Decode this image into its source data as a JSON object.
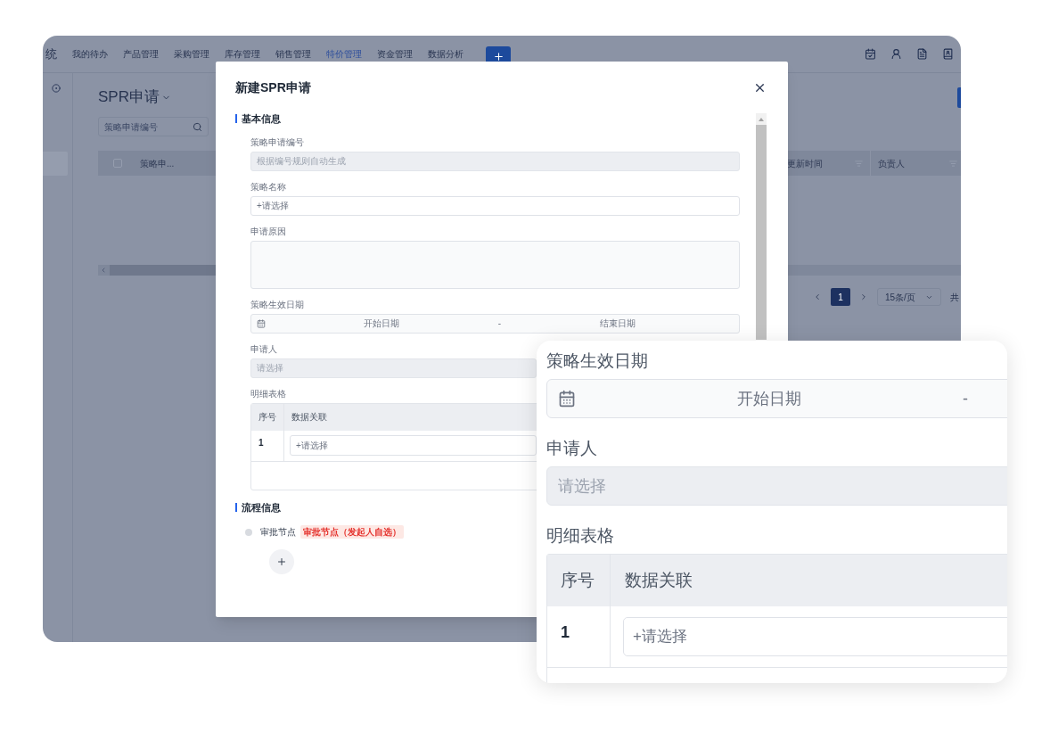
{
  "app": {
    "title_fragment": "统",
    "nav": [
      {
        "label": "我的待办",
        "selected": false
      },
      {
        "label": "产品管理",
        "selected": false
      },
      {
        "label": "采购管理",
        "selected": false
      },
      {
        "label": "库存管理",
        "selected": false
      },
      {
        "label": "销售管理",
        "selected": false
      },
      {
        "label": "特价管理",
        "selected": true
      },
      {
        "label": "资金管理",
        "selected": false
      },
      {
        "label": "数据分析",
        "selected": false
      }
    ]
  },
  "main": {
    "title": "SPR申请",
    "search_placeholder": "策略申请编号",
    "header_checkbox": {
      "checked": false
    },
    "columns": [
      {
        "label": "策略申..."
      },
      {
        "label": "更新时间"
      },
      {
        "label": "负责人"
      }
    ],
    "pagination": {
      "pages": [
        {
          "label": "1",
          "selected": true
        }
      ],
      "page_size": "15条/页",
      "total": "共"
    }
  },
  "modal": {
    "title": "新建SPR申请",
    "section_basic": "基本信息",
    "fields": [
      {
        "kind": "input",
        "label": "策略申请编号",
        "placeholder": "根据编号规则自动生成",
        "disabled": true
      },
      {
        "kind": "input",
        "label": "策略名称",
        "placeholder": "+请选择",
        "disabled": false
      },
      {
        "kind": "textarea",
        "label": "申请原因"
      },
      {
        "kind": "daterange",
        "label": "策略生效日期",
        "start": "开始日期",
        "separator": "-",
        "end": "结束日期"
      },
      {
        "kind": "input",
        "label": "申请人",
        "placeholder": "请选择",
        "disabled": true
      },
      {
        "kind": "table",
        "label": "明细表格",
        "columns": [
          "序号",
          "数据关联"
        ],
        "rows": [
          {
            "index": "1",
            "placeholder": "+请选择"
          }
        ]
      }
    ],
    "section_process": "流程信息",
    "nodes": [
      {
        "label": "审批节点",
        "tag": "审批节点（发起人自选）"
      }
    ]
  },
  "zoom_card": {
    "fields": [
      {
        "kind": "daterange",
        "label": "策略生效日期",
        "start": "开始日期",
        "separator": "-"
      },
      {
        "kind": "input",
        "label": "申请人",
        "placeholder": "请选择",
        "disabled": true
      },
      {
        "kind": "table",
        "label": "明细表格",
        "columns": [
          "序号",
          "数据关联"
        ],
        "rows": [
          {
            "index": "1",
            "placeholder": "+请选择"
          }
        ]
      }
    ]
  }
}
